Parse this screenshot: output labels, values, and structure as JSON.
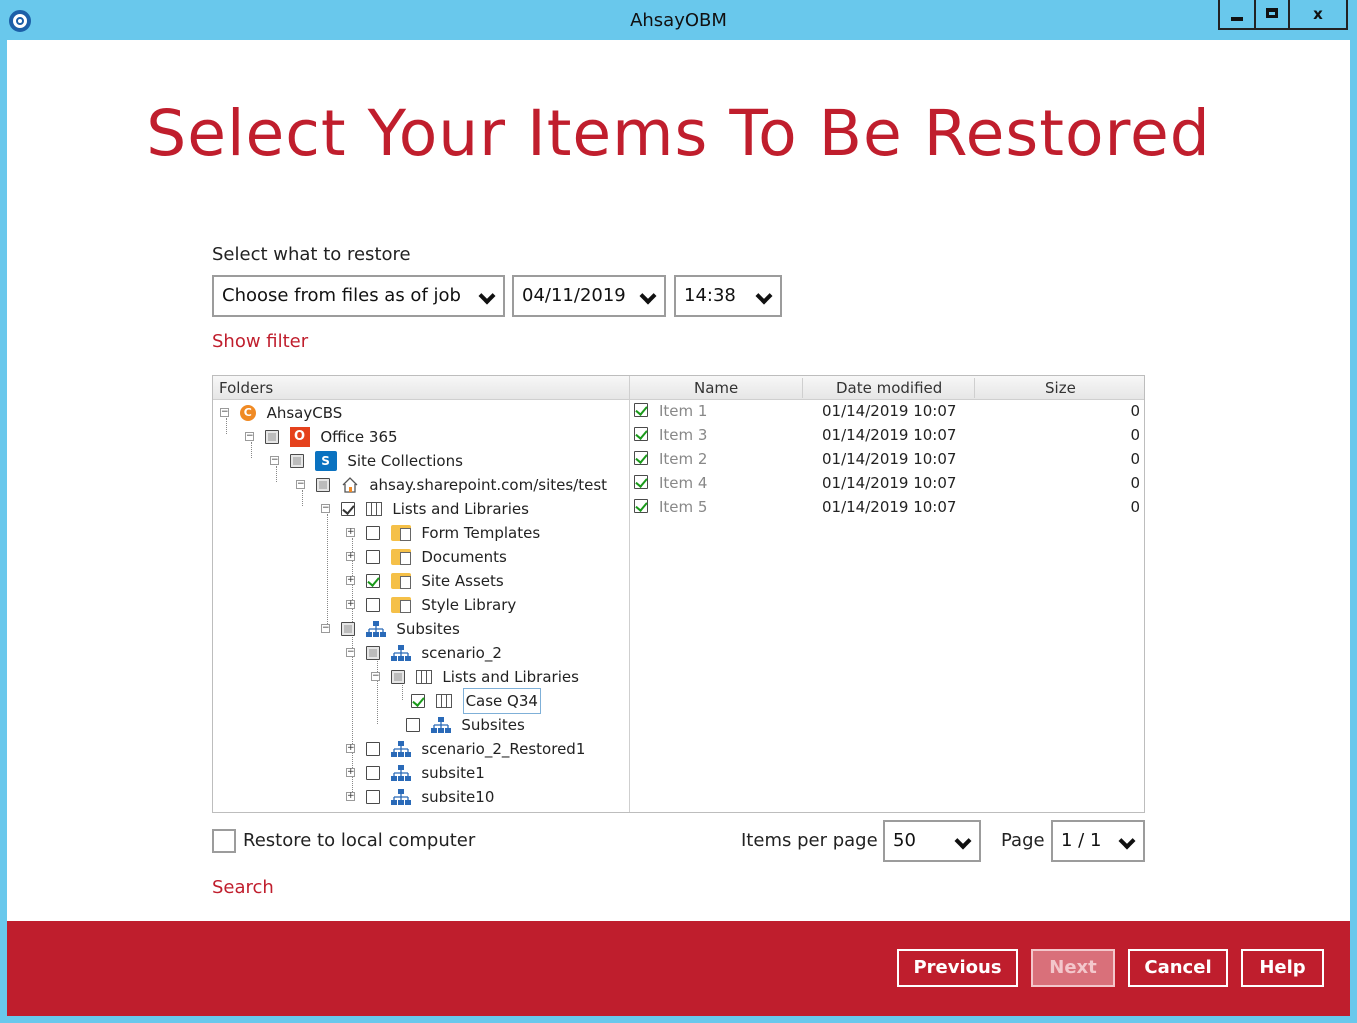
{
  "window": {
    "title": "AhsayOBM",
    "min_label": "_",
    "close_label": "x"
  },
  "page_title": "Select Your Items To Be Restored",
  "restore_selector": {
    "label": "Select what to restore",
    "mode": "Choose from files as of job",
    "date": "04/11/2019",
    "time": "14:38"
  },
  "show_filter": "Show filter",
  "tree": {
    "header": "Folders",
    "nodes": [
      {
        "label": "AhsayCBS",
        "icon": "ahsaycbs-icon"
      },
      {
        "label": "Office 365",
        "icon": "office365-icon"
      },
      {
        "label": "Site Collections",
        "icon": "sharepoint-icon"
      },
      {
        "label": "ahsay.sharepoint.com/sites/test",
        "icon": "home-icon"
      },
      {
        "label": "Lists and Libraries",
        "icon": "list-icon"
      },
      {
        "label": "Form Templates",
        "icon": "folder-icon"
      },
      {
        "label": "Documents",
        "icon": "folder-icon"
      },
      {
        "label": "Site Assets",
        "icon": "folder-icon"
      },
      {
        "label": "Style Library",
        "icon": "folder-icon"
      },
      {
        "label": "Subsites",
        "icon": "sitemap-icon"
      },
      {
        "label": "scenario_2",
        "icon": "sitemap-icon"
      },
      {
        "label": "Lists and Libraries",
        "icon": "list-icon"
      },
      {
        "label": "Case Q34",
        "icon": "list-icon"
      },
      {
        "label": "Subsites",
        "icon": "sitemap-icon"
      },
      {
        "label": "scenario_2_Restored1",
        "icon": "sitemap-icon"
      },
      {
        "label": "subsite1",
        "icon": "sitemap-icon"
      },
      {
        "label": "subsite10",
        "icon": "sitemap-icon"
      }
    ]
  },
  "file_list": {
    "columns": [
      "Name",
      "Date modified",
      "Size"
    ],
    "rows": [
      {
        "name": "Item 1",
        "date": "01/14/2019 10:07",
        "size": "0"
      },
      {
        "name": "Item 3",
        "date": "01/14/2019 10:07",
        "size": "0"
      },
      {
        "name": "Item 2",
        "date": "01/14/2019 10:07",
        "size": "0"
      },
      {
        "name": "Item 4",
        "date": "01/14/2019 10:07",
        "size": "0"
      },
      {
        "name": "Item 5",
        "date": "01/14/2019 10:07",
        "size": "0"
      }
    ]
  },
  "restore_local": "Restore to local computer",
  "items_per_page": {
    "label": "Items per page",
    "value": "50"
  },
  "page": {
    "label": "Page",
    "value": "1 / 1"
  },
  "search": "Search",
  "buttons": {
    "previous": "Previous",
    "next": "Next",
    "cancel": "Cancel",
    "help": "Help"
  },
  "colors": {
    "accent": "#c01e2d",
    "titlebar": "#69c8ec",
    "footer": "#bf1e2d"
  }
}
